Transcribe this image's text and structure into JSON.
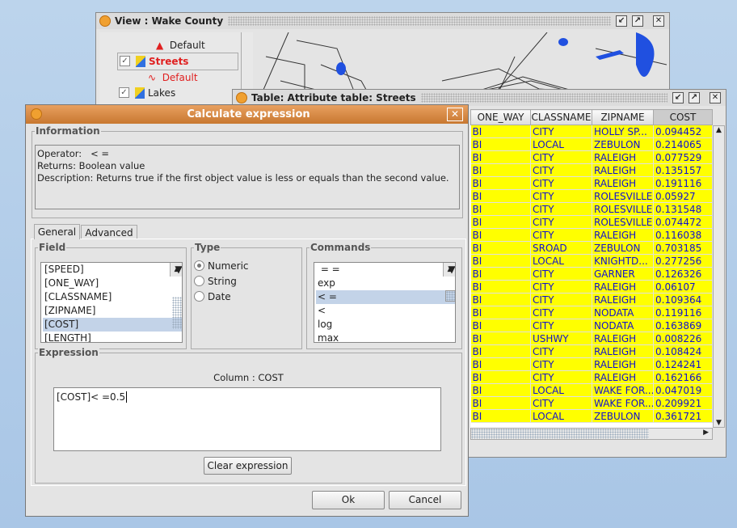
{
  "view": {
    "title": "View : Wake County",
    "layers": [
      {
        "label": "Default",
        "type": "symbol"
      },
      {
        "label": "Streets",
        "checked": true
      },
      {
        "label": "Default",
        "type": "symbol"
      },
      {
        "label": "Lakes",
        "checked": true
      }
    ]
  },
  "table": {
    "title": "Table: Attribute table: Streets",
    "columns": [
      "ONE_WAY",
      "CLASSNAME",
      "ZIPNAME",
      "COST"
    ],
    "rows": [
      [
        "BI",
        "CITY",
        "HOLLY SP...",
        "0.094452"
      ],
      [
        "BI",
        "LOCAL",
        "ZEBULON",
        "0.214065"
      ],
      [
        "BI",
        "CITY",
        "RALEIGH",
        "0.077529"
      ],
      [
        "BI",
        "CITY",
        "RALEIGH",
        "0.135157"
      ],
      [
        "BI",
        "CITY",
        "RALEIGH",
        "0.191116"
      ],
      [
        "BI",
        "CITY",
        "ROLESVILLE",
        "0.05927"
      ],
      [
        "BI",
        "CITY",
        "ROLESVILLE",
        "0.131548"
      ],
      [
        "BI",
        "CITY",
        "ROLESVILLE",
        "0.074472"
      ],
      [
        "BI",
        "CITY",
        "RALEIGH",
        "0.116038"
      ],
      [
        "BI",
        "SROAD",
        "ZEBULON",
        "0.703185"
      ],
      [
        "BI",
        "LOCAL",
        "KNIGHTD...",
        "0.277256"
      ],
      [
        "BI",
        "CITY",
        "GARNER",
        "0.126326"
      ],
      [
        "BI",
        "CITY",
        "RALEIGH",
        "0.06107"
      ],
      [
        "BI",
        "CITY",
        "RALEIGH",
        "0.109364"
      ],
      [
        "BI",
        "CITY",
        "NODATA",
        "0.119116"
      ],
      [
        "BI",
        "CITY",
        "NODATA",
        "0.163869"
      ],
      [
        "BI",
        "USHWY",
        "RALEIGH",
        "0.008226"
      ],
      [
        "BI",
        "CITY",
        "RALEIGH",
        "0.108424"
      ],
      [
        "BI",
        "CITY",
        "RALEIGH",
        "0.124241"
      ],
      [
        "BI",
        "CITY",
        "RALEIGH",
        "0.162166"
      ],
      [
        "BI",
        "LOCAL",
        "WAKE FOR...",
        "0.047019"
      ],
      [
        "BI",
        "CITY",
        "WAKE FOR...",
        "0.209921"
      ],
      [
        "BI",
        "LOCAL",
        "ZEBULON",
        "0.361721"
      ]
    ]
  },
  "dialog": {
    "title": "Calculate expression",
    "information": {
      "legend": "Information",
      "operator": "Operator:   < =",
      "returns": "Returns:  Boolean value",
      "description": "Description:  Returns true if the first object value is less or equals than the second value."
    },
    "tabs": [
      "General",
      "Advanced"
    ],
    "field": {
      "legend": "Field",
      "items": [
        "[SPEED]",
        "[ONE_WAY]",
        "[CLASSNAME]",
        "[ZIPNAME]",
        "[COST]",
        "[LENGTH]"
      ],
      "selected": "[COST]"
    },
    "type": {
      "legend": "Type",
      "options": [
        "Numeric",
        "String",
        "Date"
      ],
      "selected": "Numeric"
    },
    "commands": {
      "legend": "Commands",
      "items": [
        " = =",
        "exp",
        "< =",
        "<",
        "log",
        "max"
      ],
      "selected": "< ="
    },
    "expression": {
      "legend": "Expression",
      "column": "Column :  COST",
      "value": "[COST]< =0.5",
      "clear": "Clear expression"
    },
    "ok": "Ok",
    "cancel": "Cancel"
  },
  "colors": {
    "row_bg": "#ffff00",
    "row_text": "#1010d0",
    "dialog_title": "#d88a3a"
  }
}
